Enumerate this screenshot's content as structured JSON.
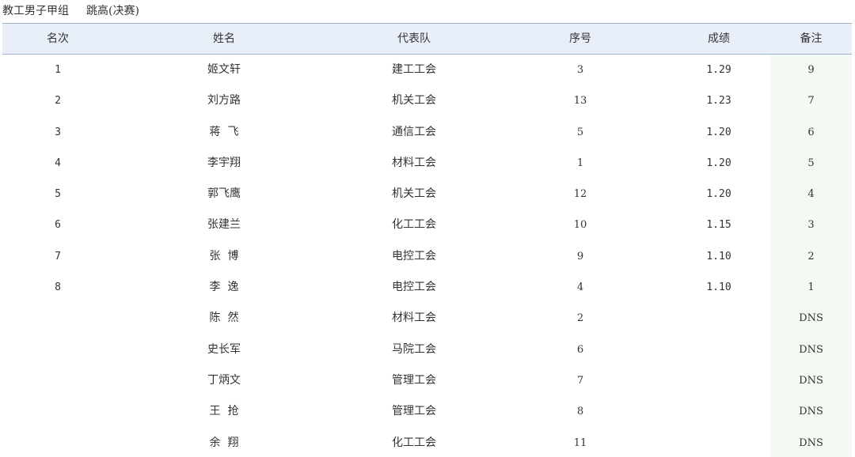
{
  "caption": {
    "group": "教工男子甲组",
    "event": "跳高(决赛)"
  },
  "table": {
    "columns": [
      "名次",
      "姓名",
      "代表队",
      "序号",
      "成绩",
      "备注"
    ],
    "rows": [
      {
        "rank": "1",
        "name": "姬文轩",
        "team": "建工工会",
        "no": "3",
        "score": "1.29",
        "note": "9"
      },
      {
        "rank": "2",
        "name": "刘方路",
        "team": "机关工会",
        "no": "13",
        "score": "1.23",
        "note": "7"
      },
      {
        "rank": "3",
        "name": "蒋  飞",
        "team": "通信工会",
        "no": "5",
        "score": "1.20",
        "note": "6"
      },
      {
        "rank": "4",
        "name": "李宇翔",
        "team": "材料工会",
        "no": "1",
        "score": "1.20",
        "note": "5"
      },
      {
        "rank": "5",
        "name": "郭飞鹰",
        "team": "机关工会",
        "no": "12",
        "score": "1.20",
        "note": "4"
      },
      {
        "rank": "6",
        "name": "张建兰",
        "team": "化工工会",
        "no": "10",
        "score": "1.15",
        "note": "3"
      },
      {
        "rank": "7",
        "name": "张  博",
        "team": "电控工会",
        "no": "9",
        "score": "1.10",
        "note": "2"
      },
      {
        "rank": "8",
        "name": "李  逸",
        "team": "电控工会",
        "no": "4",
        "score": "1.10",
        "note": "1"
      },
      {
        "rank": "",
        "name": "陈  然",
        "team": "材料工会",
        "no": "2",
        "score": "",
        "note": "DNS"
      },
      {
        "rank": "",
        "name": "史长军",
        "team": "马院工会",
        "no": "6",
        "score": "",
        "note": "DNS"
      },
      {
        "rank": "",
        "name": "丁炳文",
        "team": "管理工会",
        "no": "7",
        "score": "",
        "note": "DNS"
      },
      {
        "rank": "",
        "name": "王  抢",
        "team": "管理工会",
        "no": "8",
        "score": "",
        "note": "DNS"
      },
      {
        "rank": "",
        "name": "余  翔",
        "team": "化工工会",
        "no": "11",
        "score": "",
        "note": "DNS"
      }
    ]
  }
}
